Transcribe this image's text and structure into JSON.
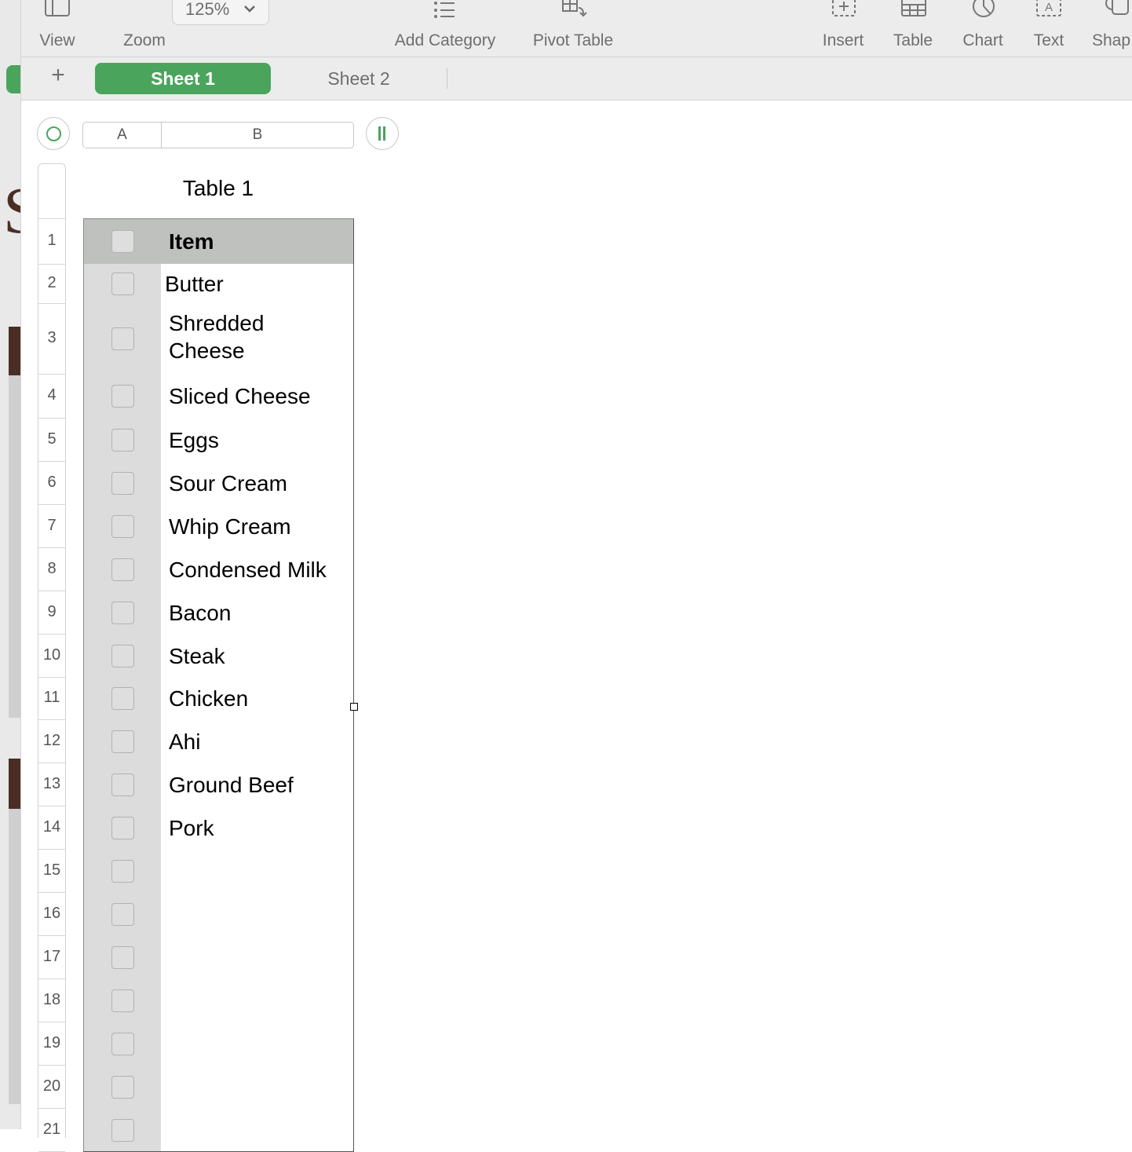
{
  "toolbar": {
    "view_label": "View",
    "zoom_value": "125%",
    "zoom_label": "Zoom",
    "add_category_label": "Add Category",
    "pivot_table_label": "Pivot Table",
    "insert_label": "Insert",
    "table_label": "Table",
    "chart_label": "Chart",
    "text_label": "Text",
    "shape_label": "Shap"
  },
  "tabs": {
    "add": "+",
    "sheets": [
      {
        "label": "Sheet 1",
        "active": true
      },
      {
        "label": "Sheet 2",
        "active": false
      }
    ]
  },
  "columns": [
    "A",
    "B"
  ],
  "table": {
    "title": "Table 1",
    "header": "Item",
    "rows": [
      {
        "num": "2",
        "item": "Butter"
      },
      {
        "num": "3",
        "item": "Shredded Cheese"
      },
      {
        "num": "4",
        "item": "Sliced Cheese"
      },
      {
        "num": "5",
        "item": "Eggs"
      },
      {
        "num": "6",
        "item": "Sour Cream"
      },
      {
        "num": "7",
        "item": "Whip Cream"
      },
      {
        "num": "8",
        "item": "Condensed Milk"
      },
      {
        "num": "9",
        "item": "Bacon"
      },
      {
        "num": "10",
        "item": "Steak"
      },
      {
        "num": "11",
        "item": "Chicken"
      },
      {
        "num": "12",
        "item": "Ahi"
      },
      {
        "num": "13",
        "item": "Ground Beef"
      },
      {
        "num": "14",
        "item": "Pork"
      },
      {
        "num": "15",
        "item": ""
      },
      {
        "num": "16",
        "item": ""
      },
      {
        "num": "17",
        "item": ""
      },
      {
        "num": "18",
        "item": ""
      },
      {
        "num": "19",
        "item": ""
      },
      {
        "num": "20",
        "item": ""
      },
      {
        "num": "21",
        "item": ""
      }
    ],
    "header_row_num": "1"
  },
  "colors": {
    "accent": "#4aa45c",
    "header_fill": "#bfc1bf",
    "checkbox_col": "#dcdcdc"
  }
}
